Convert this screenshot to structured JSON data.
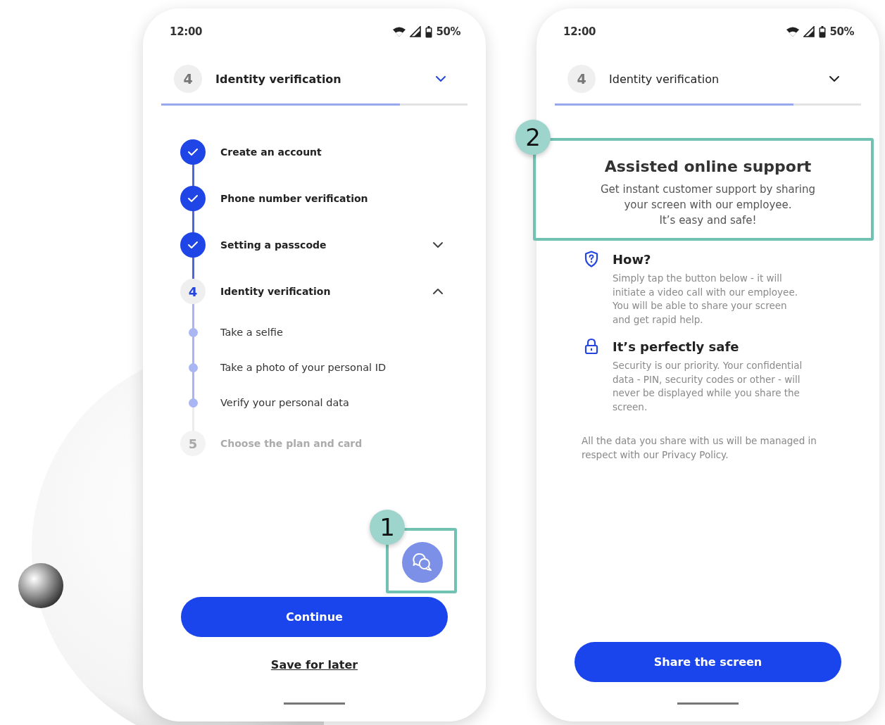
{
  "phones": [
    {
      "kind": "steps",
      "status_bar": {
        "time": "12:00",
        "battery": "50%"
      },
      "header": {
        "step": "4",
        "title": "Identity verification",
        "active": true,
        "progress": {
          "level": 0.78
        }
      },
      "steps": [
        {
          "kind": "done",
          "label": "Create an account"
        },
        {
          "kind": "done",
          "label": "Phone number verification"
        },
        {
          "kind": "done",
          "label": "Setting a passcode",
          "expanded": false
        },
        {
          "kind": "current",
          "number": "4",
          "label": "Identity verification",
          "expanded": true,
          "children": [
            {
              "label": "Take a selfie"
            },
            {
              "label": "Take a photo of your personal ID"
            },
            {
              "label": "Verify your personal data"
            }
          ]
        },
        {
          "kind": "upcoming",
          "number": "5",
          "label": "Choose the plan and card"
        }
      ],
      "chat_button": {
        "callout": "1"
      },
      "primary_button": "Continue",
      "link": "Save for later"
    },
    {
      "kind": "info",
      "status_bar": {
        "time": "12:00",
        "battery": "50%"
      },
      "header": {
        "step": "4",
        "title": "Identity verification",
        "active": false,
        "progress": {
          "level": 0.78
        }
      },
      "intro": {
        "callout": "2",
        "title": "Assisted online support",
        "text": "Get instant customer support by sharing\nyour screen with our employee.\nIt’s easy and safe!"
      },
      "features": [
        {
          "kind": "shield",
          "title": "How?",
          "text": "Simply tap the button below - it will\ninitiate a video call with our employee.\nYou will be able to share your screen\nand get rapid help."
        },
        {
          "kind": "lock",
          "title": "It’s perfectly safe",
          "text": "Security is our priority. Your confidential\ndata - PIN, security codes or other - will\nnever be displayed while you share the\nscreen."
        }
      ],
      "note": "All the data you share with us will be managed in\nrespect with our Privacy Policy.",
      "primary_button": "Share the screen"
    }
  ]
}
